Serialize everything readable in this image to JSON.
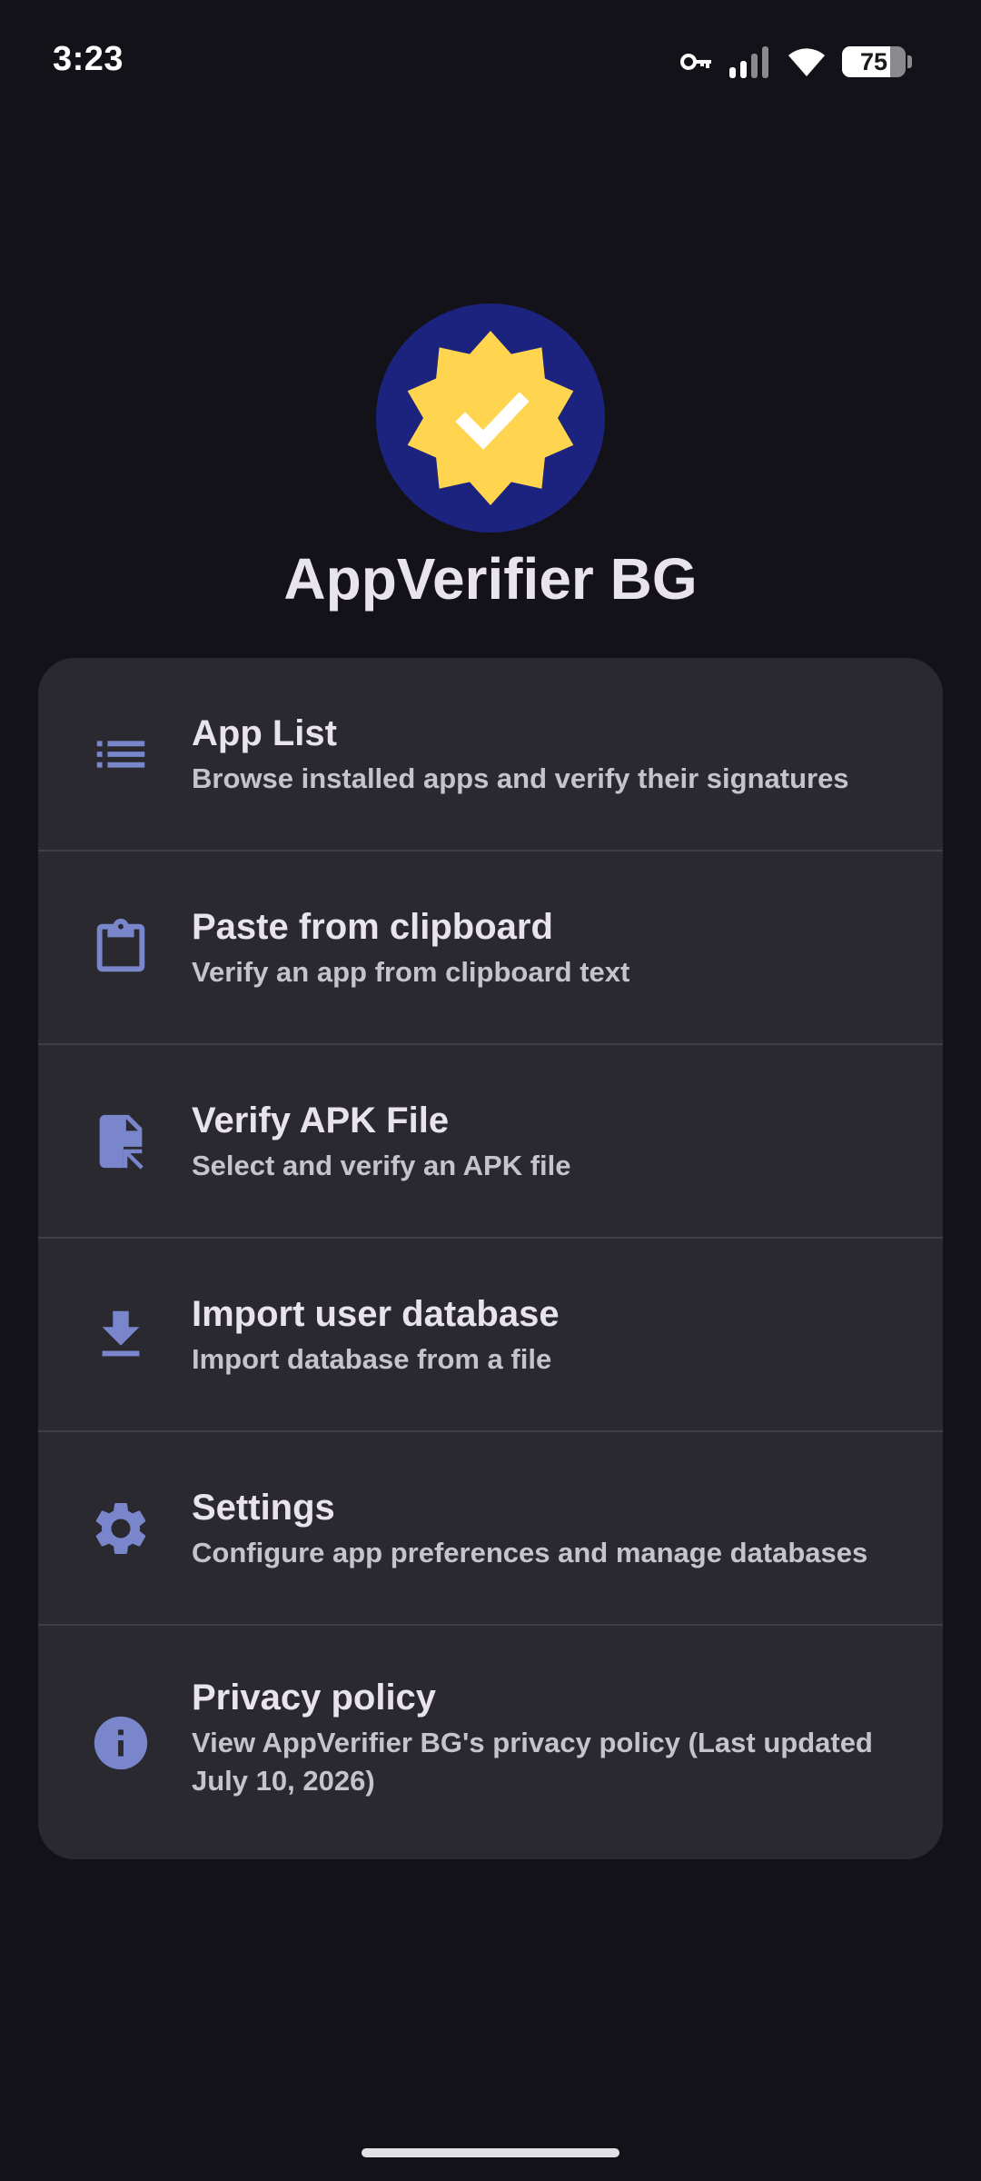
{
  "status_bar": {
    "time": "3:23",
    "battery_level": "75",
    "battery_fraction": 0.75,
    "icons": [
      "vpn-key-icon",
      "signal-icon",
      "wifi-icon",
      "battery-icon"
    ]
  },
  "app": {
    "title": "AppVerifier BG",
    "logo_icon": "verified-badge-icon",
    "colors": {
      "logo_background": "#1b237e",
      "logo_badge": "#ffd54f",
      "accent": "#7986cb",
      "card_background": "#2a292f",
      "page_background": "#131218"
    }
  },
  "menu": {
    "items": [
      {
        "icon": "list-icon",
        "title": "App List",
        "subtitle": "Browse installed apps and verify their signatures"
      },
      {
        "icon": "clipboard-icon",
        "title": "Paste from clipboard",
        "subtitle": "Verify an app from clipboard text"
      },
      {
        "icon": "file-open-icon",
        "title": "Verify APK File",
        "subtitle": "Select and verify an APK file"
      },
      {
        "icon": "download-icon",
        "title": "Import user database",
        "subtitle": "Import database from a file"
      },
      {
        "icon": "gear-icon",
        "title": "Settings",
        "subtitle": "Configure app preferences and manage databases"
      },
      {
        "icon": "info-icon",
        "title": "Privacy policy",
        "subtitle": "View AppVerifier BG's privacy policy (Last updated July 10, 2026)"
      }
    ]
  }
}
